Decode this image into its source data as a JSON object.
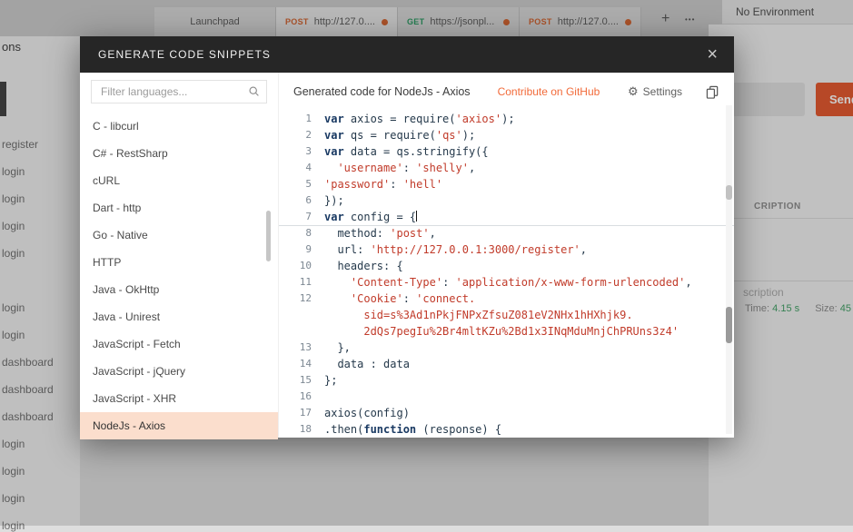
{
  "background": {
    "active_tab": 1,
    "tabs": [
      {
        "method": "",
        "label": "Launchpad",
        "dot": false
      },
      {
        "method": "POST",
        "label": "http://127.0....",
        "dot": true
      },
      {
        "method": "GET",
        "label": "https://jsonpl...",
        "dot": true
      },
      {
        "method": "POST",
        "label": "http://127.0....",
        "dot": true
      }
    ],
    "tab_add": "+",
    "tab_more": "•••",
    "environment": "No Environment",
    "send_label": "Send",
    "sidebar_heading": "ons",
    "history_items": [
      "register",
      "login",
      "login",
      "login",
      "login",
      "login",
      "login",
      "dashboard",
      "dashboard",
      "dashboard",
      "login",
      "login",
      "login",
      "login"
    ],
    "description_header": "CRIPTION",
    "description_placeholder": "scription",
    "meta": {
      "time_label": "Time:",
      "time_value": "4.15 s",
      "size_label": "Size:",
      "size_value": "45"
    }
  },
  "modal": {
    "title": "GENERATE CODE SNIPPETS",
    "close_glyph": "×",
    "filter_placeholder": "Filter languages...",
    "languages": [
      "C - libcurl",
      "C# - RestSharp",
      "cURL",
      "Dart - http",
      "Go - Native",
      "HTTP",
      "Java - OkHttp",
      "Java - Unirest",
      "JavaScript - Fetch",
      "JavaScript - jQuery",
      "JavaScript - XHR",
      "NodeJs - Axios"
    ],
    "selected_language": "NodeJs - Axios",
    "header": {
      "title": "Generated code for NodeJs - Axios",
      "contribute_label": "Contribute on GitHub",
      "settings_label": "Settings",
      "gear_glyph": "⚙"
    },
    "code": {
      "lines": [
        {
          "n": "1",
          "segs": [
            [
              "k",
              "var"
            ],
            [
              "p",
              " axios = require("
            ],
            [
              "s",
              "'axios'"
            ],
            [
              "p",
              ");"
            ]
          ]
        },
        {
          "n": "2",
          "segs": [
            [
              "k",
              "var"
            ],
            [
              "p",
              " qs = require("
            ],
            [
              "s",
              "'qs'"
            ],
            [
              "p",
              ");"
            ]
          ]
        },
        {
          "n": "3",
          "segs": [
            [
              "k",
              "var"
            ],
            [
              "p",
              " data = qs.stringify({"
            ]
          ]
        },
        {
          "n": "4",
          "segs": [
            [
              "p",
              "  "
            ],
            [
              "s",
              "'username'"
            ],
            [
              "p",
              ": "
            ],
            [
              "s",
              "'shelly'"
            ],
            [
              "p",
              ","
            ]
          ]
        },
        {
          "n": "5",
          "segs": [
            [
              "s",
              "'password'"
            ],
            [
              "p",
              ": "
            ],
            [
              "s",
              "'hell'"
            ]
          ]
        },
        {
          "n": "6",
          "segs": [
            [
              "p",
              "});"
            ]
          ]
        },
        {
          "n": "7",
          "segs": [
            [
              "k",
              "var"
            ],
            [
              "p",
              " config = {"
            ]
          ],
          "cursor": true,
          "active": true
        },
        {
          "n": "8",
          "segs": [
            [
              "p",
              "  method: "
            ],
            [
              "s",
              "'post'"
            ],
            [
              "p",
              ","
            ]
          ]
        },
        {
          "n": "9",
          "segs": [
            [
              "p",
              "  url: "
            ],
            [
              "s",
              "'http://127.0.0.1:3000/register'"
            ],
            [
              "p",
              ","
            ]
          ]
        },
        {
          "n": "10",
          "segs": [
            [
              "p",
              "  headers: { "
            ]
          ]
        },
        {
          "n": "11",
          "segs": [
            [
              "p",
              "    "
            ],
            [
              "s",
              "'Content-Type'"
            ],
            [
              "p",
              ": "
            ],
            [
              "s",
              "'application/x-www-form-urlencoded'"
            ],
            [
              "p",
              ", "
            ]
          ]
        },
        {
          "n": "12",
          "segs": [
            [
              "p",
              "    "
            ],
            [
              "s",
              "'Cookie'"
            ],
            [
              "p",
              ": "
            ],
            [
              "s",
              "'connect."
            ]
          ]
        },
        {
          "n": "",
          "segs": [
            [
              "s",
              "      sid=s%3Ad1nPkjFNPxZfsuZ081eV2NHx1hHXhjk9."
            ]
          ]
        },
        {
          "n": "",
          "segs": [
            [
              "s",
              "      2dQs7pegIu%2Br4mltKZu%2Bd1x3INqMduMnjChPRUns3z4'"
            ]
          ]
        },
        {
          "n": "13",
          "segs": [
            [
              "p",
              "  },"
            ]
          ]
        },
        {
          "n": "14",
          "segs": [
            [
              "p",
              "  data : data"
            ]
          ]
        },
        {
          "n": "15",
          "segs": [
            [
              "p",
              "};"
            ]
          ]
        },
        {
          "n": "16",
          "segs": []
        },
        {
          "n": "17",
          "segs": [
            [
              "p",
              "axios(config)"
            ]
          ]
        },
        {
          "n": "18",
          "segs": [
            [
              "p",
              ".then("
            ],
            [
              "k",
              "function"
            ],
            [
              "p",
              " (response) {"
            ]
          ]
        }
      ]
    }
  },
  "colors": {
    "accent": "#f26b3a",
    "method_post": "#d4632f",
    "method_get": "#2a9a62",
    "selected_language_bg": "#fbdecd",
    "code_string": "#c13b2a",
    "code_keyword": "#1a3a63",
    "modal_header_bg": "#262626"
  }
}
